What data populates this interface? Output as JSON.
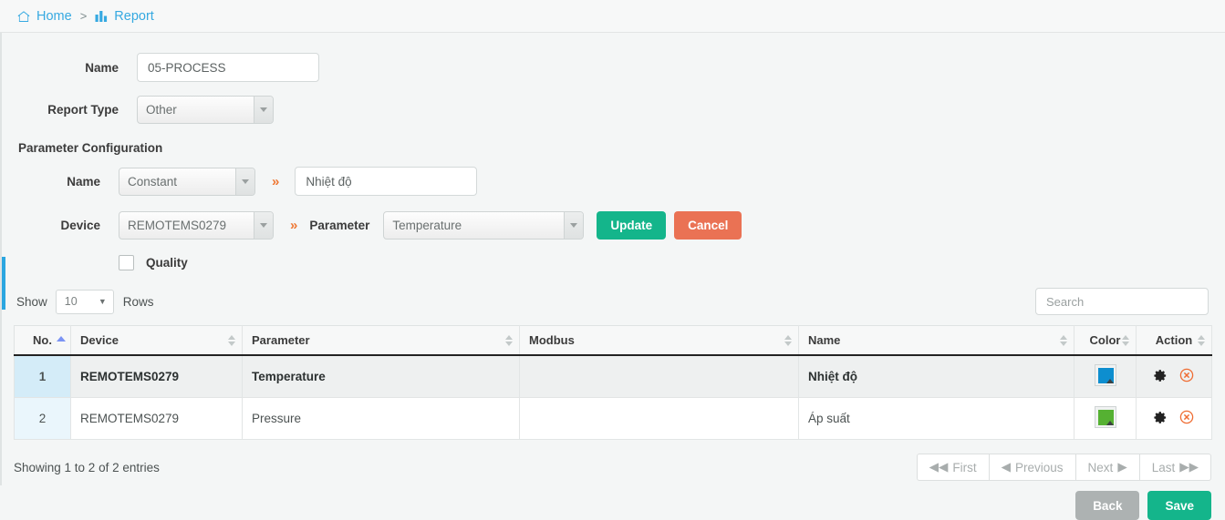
{
  "breadcrumb": {
    "home_label": "Home",
    "separator": ">",
    "report_label": "Report",
    "home_icon": "house-icon",
    "report_icon": "bar-chart-icon",
    "link_color": "#36a9e1"
  },
  "form": {
    "name_label": "Name",
    "name_value": "05-PROCESS",
    "report_type_label": "Report Type",
    "report_type_value": "Other"
  },
  "param_config": {
    "section_title": "Parameter Configuration",
    "name_label": "Name",
    "name_type_value": "Constant",
    "chevron": "»",
    "name_text_value": "Nhiệt độ",
    "device_label": "Device",
    "device_value": "REMOTEMS0279",
    "parameter_label": "Parameter",
    "parameter_value": "Temperature",
    "update_label": "Update",
    "cancel_label": "Cancel",
    "update_color": "#14b58b",
    "cancel_color": "#ea7254",
    "quality_label": "Quality",
    "quality_checked": false
  },
  "table_controls": {
    "show_label": "Show",
    "rows_count": "10",
    "rows_label": "Rows",
    "search_placeholder": "Search"
  },
  "table": {
    "columns": [
      {
        "label": "No.",
        "sorted": "asc"
      },
      {
        "label": "Device",
        "sorted": "none"
      },
      {
        "label": "Parameter",
        "sorted": "none"
      },
      {
        "label": "Modbus",
        "sorted": "none"
      },
      {
        "label": "Name",
        "sorted": "none"
      },
      {
        "label": "Color",
        "sorted": "none"
      },
      {
        "label": "Action",
        "sorted": "none"
      }
    ],
    "rows": [
      {
        "no": "1",
        "device": "REMOTEMS0279",
        "parameter": "Temperature",
        "modbus": "",
        "name": "Nhiệt độ",
        "color": "#0d8ecf",
        "selected": true
      },
      {
        "no": "2",
        "device": "REMOTEMS0279",
        "parameter": "Pressure",
        "modbus": "",
        "name": "Áp suất",
        "color": "#55b132",
        "selected": false
      }
    ]
  },
  "footer": {
    "entries_info": "Showing 1 to 2 of 2 entries",
    "pagination": [
      {
        "label": "First",
        "icon": "double-left-icon",
        "side": "left"
      },
      {
        "label": "Previous",
        "icon": "left-icon",
        "side": "left"
      },
      {
        "label": "Next",
        "icon": "right-icon",
        "side": "right"
      },
      {
        "label": "Last",
        "icon": "double-right-icon",
        "side": "right"
      }
    ],
    "back_label": "Back",
    "save_label": "Save",
    "back_color": "#adb2b2",
    "save_color": "#14b58b"
  }
}
